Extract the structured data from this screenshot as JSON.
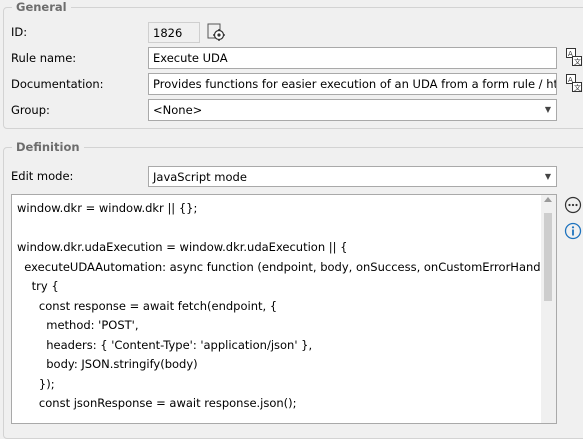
{
  "general": {
    "title": "General",
    "id_label": "ID:",
    "id_value": "1826",
    "rule_name_label": "Rule name:",
    "rule_name_value": "Execute UDA",
    "documentation_label": "Documentation:",
    "documentation_value": "Provides functions for easier execution of an UDA from a form rule / html field.",
    "group_label": "Group:",
    "group_value": "<None>"
  },
  "definition": {
    "title": "Definition",
    "edit_mode_label": "Edit mode:",
    "edit_mode_value": "JavaScript mode",
    "code_lines": [
      "window.dkr = window.dkr || {};",
      "",
      "window.dkr.udaExecution = window.dkr.udaExecution || {",
      "  executeUDAAutomation: async function (endpoint, body, onSuccess, onCustomErrorHandling) {",
      "    try {",
      "      const response = await fetch(endpoint, {",
      "        method: 'POST',",
      "        headers: { 'Content-Type': 'application/json' },",
      "        body: JSON.stringify(body)",
      "      });",
      "      const jsonResponse = await response.json();"
    ]
  },
  "icons": {
    "id_settings": "settings-gear-icon",
    "translate_rule_name": "translate-icon",
    "translate_documentation": "translate-icon",
    "more": "more-options-icon",
    "info": "info-icon"
  },
  "colors": {
    "accent_blue": "#1e73be",
    "border": "#a9a9a9",
    "background": "#f0f0f0"
  }
}
